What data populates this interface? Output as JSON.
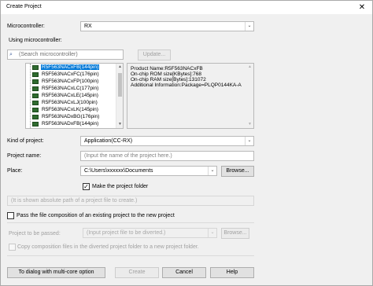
{
  "window": {
    "title": "Create Project",
    "close_glyph": "✕"
  },
  "microcontroller": {
    "label": "Microcontroller:",
    "value": "RX"
  },
  "using_microcontroller": {
    "label": "Using microcontroller:",
    "search_placeholder": "(Search microcontroller)",
    "update_label": "Update..."
  },
  "tree_items": [
    "R5F563NACxFB(144pin)",
    "R5F563NACxFC(176pin)",
    "R5F563NACxFP(100pin)",
    "R5F563NACxLC(177pin)",
    "R5F563NACxLE(145pin)",
    "R5F563NACxLJ(100pin)",
    "R5F563NACxLK(145pin)",
    "R5F563NADxBG(176pin)",
    "R5F563NADxFB(144pin)"
  ],
  "info_panel": {
    "lines": [
      "Product Name:R5F563NACxFB",
      "On-chip ROM size[KBytes]:768",
      "On-chip RAM size[Bytes]:131072",
      "Additional Information:Package=PLQP0144KA-A"
    ]
  },
  "kind_of_project": {
    "label": "Kind of project:",
    "value": "Application(CC-RX)"
  },
  "project_name": {
    "label": "Project name:",
    "placeholder": "(Input the name of the project here.)"
  },
  "place": {
    "label": "Place:",
    "value": "C:\\Users\\xxxxxx\\Documents",
    "browse_label": "Browse..."
  },
  "make_folder": {
    "label": "Make the project folder",
    "checked": true,
    "check_glyph": "✓"
  },
  "absolute_path_hint": "(It is shown absolute path of a project file to create.)",
  "pass_composition": {
    "label": "Pass the file composition of an existing project to the new project",
    "checked": false
  },
  "project_to_be_passed": {
    "label": "Project to be passed:",
    "placeholder": "(Input project file to be diverted.)",
    "browse_label": "Browse..."
  },
  "copy_composition": {
    "label": "Copy composition files in the diverted project folder to a new project folder.",
    "checked": false
  },
  "buttons": {
    "multicore": "To dialog with multi-core option",
    "create": "Create",
    "cancel": "Cancel",
    "help": "Help"
  }
}
